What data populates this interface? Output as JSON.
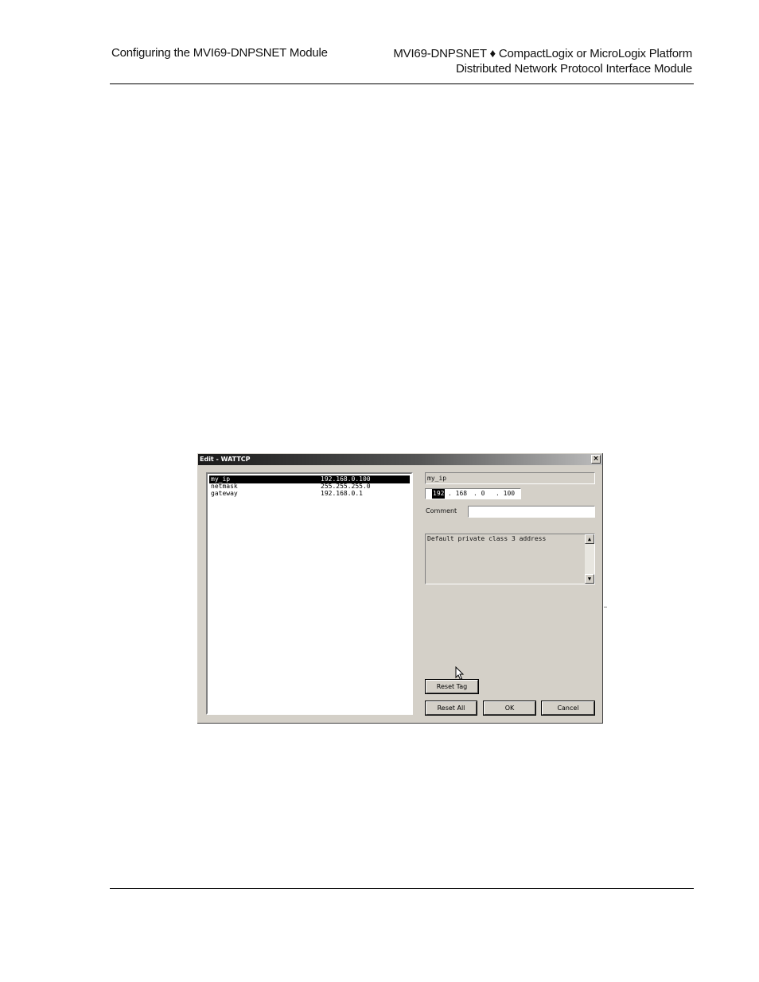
{
  "header": {
    "left": "Configuring the MVI69-DNPSNET Module",
    "right_line1": "MVI69-DNPSNET ♦ CompactLogix or MicroLogix Platform",
    "right_line2": "Distributed Network Protocol Interface Module"
  },
  "dialog": {
    "title": "Edit - WATTCP",
    "close_glyph": "×",
    "rows": [
      {
        "key": "my_ip",
        "value": "192.168.0.100"
      },
      {
        "key": "netmask",
        "value": "255.255.255.0"
      },
      {
        "key": "gateway",
        "value": "192.168.0.1"
      }
    ],
    "selected_row": "my_ip",
    "tag_name": "my_ip",
    "ip": {
      "o1": "192",
      "o2": ". 168",
      "o3": ".   0",
      "o4": ". 100"
    },
    "comment_label": "Comment",
    "comment_value": "",
    "description": "Default private class 3 address",
    "buttons": {
      "reset_tag": "Reset Tag",
      "reset_all": "Reset All",
      "ok": "OK",
      "cancel": "Cancel"
    }
  }
}
